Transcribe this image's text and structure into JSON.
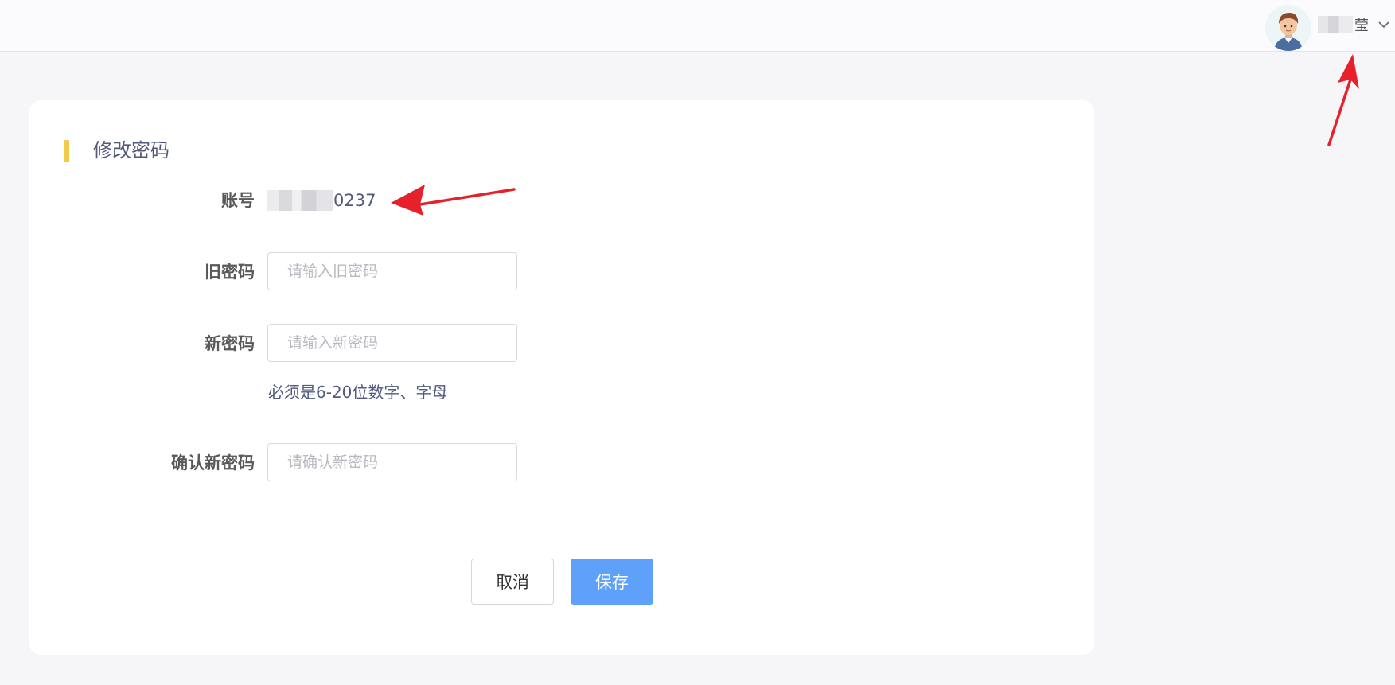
{
  "header": {
    "user": {
      "name_visible": "莹",
      "dropdown_icon": "chevron-down-icon"
    }
  },
  "form": {
    "title": "修改密码",
    "accent_color": "#f3c94a",
    "account": {
      "label": "账号",
      "value_visible": "0237"
    },
    "old_password": {
      "label": "旧密码",
      "placeholder": "请输入旧密码"
    },
    "new_password": {
      "label": "新密码",
      "placeholder": "请输入新密码",
      "hint": "必须是6-20位数字、字母"
    },
    "confirm_password": {
      "label": "确认新密码",
      "placeholder": "请确认新密码"
    },
    "buttons": {
      "cancel": "取消",
      "save": "保存",
      "save_color": "#5ea0fa"
    }
  },
  "annotations": {
    "arrow_color": "#e8202a"
  }
}
